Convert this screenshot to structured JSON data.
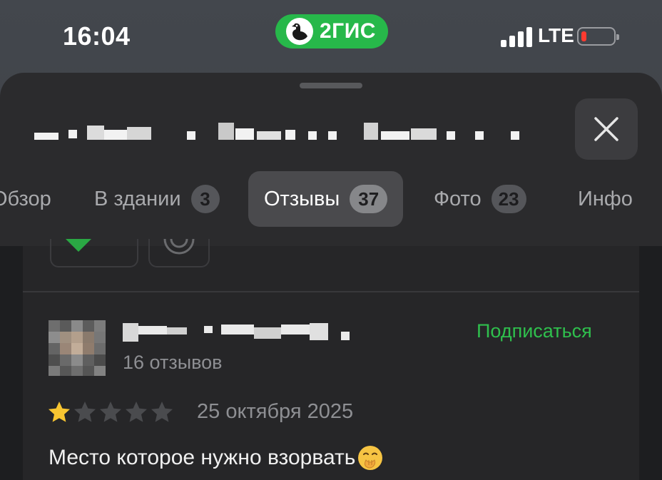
{
  "status_bar": {
    "time": "16:04",
    "app_badge": "2ГИС",
    "network": "LTE",
    "battery_color": "#ff3b30"
  },
  "header": {
    "close_icon": "close-icon"
  },
  "tabs": [
    {
      "label": "Обзор",
      "count": null
    },
    {
      "label": "В здании",
      "count": "3"
    },
    {
      "label": "Отзывы",
      "count": "37",
      "active": true
    },
    {
      "label": "Фото",
      "count": "23"
    },
    {
      "label": "Инфо",
      "count": null
    }
  ],
  "review": {
    "reviews_count": "16 отзывов",
    "subscribe_label": "Подписаться",
    "rating": 1,
    "rating_max": 5,
    "date": "25 октября 2025",
    "text": "Место которое нужно взорвать"
  },
  "colors": {
    "accent_green": "#2fbf4d",
    "star_filled": "#f7c531",
    "star_empty": "#4a4b4e"
  }
}
